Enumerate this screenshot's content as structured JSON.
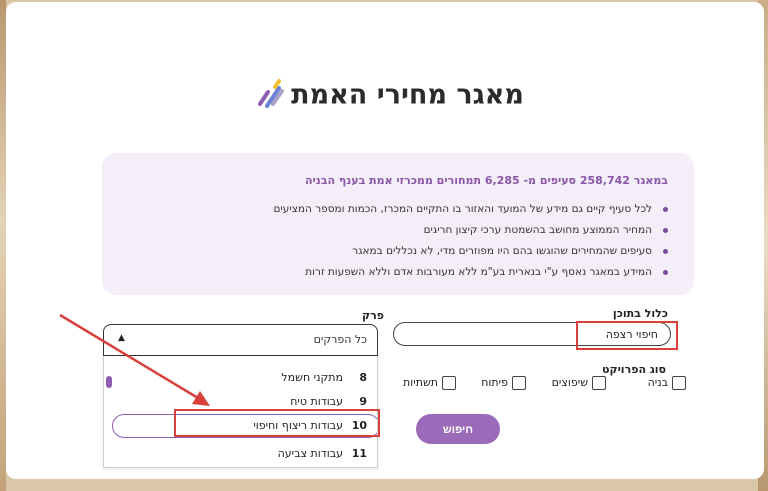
{
  "title": "מאגר מחירי האמת",
  "info": {
    "headline": "במאגר 258,742 סעיפים מ- 6,285 תמחורים ממכרזי אמת בענף הבניה",
    "bullets": [
      "לכל סעיף קיים גם מידע של המועד והאזור בו התקיים המכרז, הכמות ומספר המציעים",
      "המחיר הממוצע מחושב בהשמטת ערכי קיצון חריגים",
      "סעיפים שהמחירים שהוגשו בהם היו מפוזרים מדי, לא נכללים במאגר",
      "המידע במאגר נאסף ע\"י בנארית בע\"מ ללא מעורבות אדם וללא השפעות זרות"
    ]
  },
  "content_search": {
    "label": "כלול בתוכן",
    "value": "חיפוי רצפה"
  },
  "chapter": {
    "label": "פרק",
    "selected": "כל הפרקים",
    "options": [
      {
        "num": "8",
        "label": "מתקני חשמל"
      },
      {
        "num": "9",
        "label": "עבודות טיח"
      },
      {
        "num": "10",
        "label": "עבודות ריצוף וחיפוי"
      },
      {
        "num": "11",
        "label": "עבודות צביעה"
      }
    ]
  },
  "project_type": {
    "label": "סוג הפרויקט",
    "options": [
      "בניה",
      "שיפוצים",
      "פיתוח",
      "תשתיות"
    ]
  },
  "search_button": "חיפוש",
  "colors": {
    "accent": "#9b6bb9",
    "highlight": "#d9403a",
    "info_bg": "#f3eef7"
  }
}
